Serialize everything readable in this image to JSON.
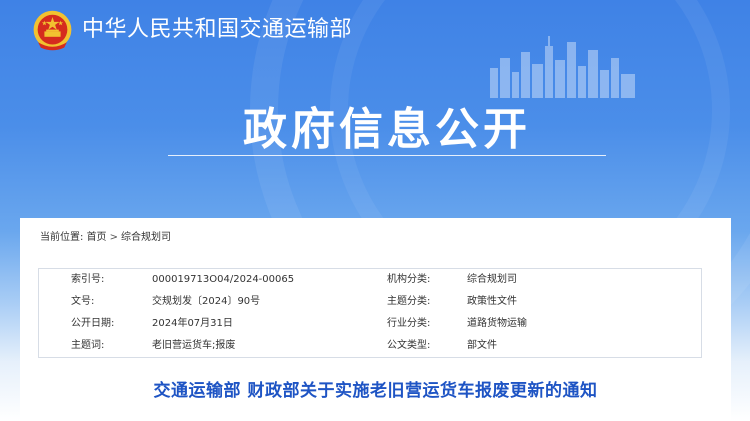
{
  "header": {
    "ministry_name": "中华人民共和国交通运输部",
    "banner_title": "政府信息公开",
    "accent_color": "#3f82e6",
    "emblem_icon": "national-emblem-icon"
  },
  "breadcrumb": {
    "label": "当前位置:",
    "items": [
      "首页",
      "综合规划司"
    ],
    "separator": ">"
  },
  "meta": {
    "rows": [
      {
        "k1": "索引号:",
        "v1": "000019713O04/2024-00065",
        "k2": "机构分类:",
        "v2": "综合规划司"
      },
      {
        "k1": "文号:",
        "v1": "交规划发〔2024〕90号",
        "k2": "主题分类:",
        "v2": "政策性文件"
      },
      {
        "k1": "公开日期:",
        "v1": "2024年07月31日",
        "k2": "行业分类:",
        "v2": "道路货物运输"
      },
      {
        "k1": "主题词:",
        "v1": "老旧营运货车;报废",
        "k2": "公文类型:",
        "v2": "部文件"
      }
    ]
  },
  "document": {
    "title": "交通运输部 财政部关于实施老旧营运货车报废更新的通知",
    "title_color": "#1e54c4"
  }
}
